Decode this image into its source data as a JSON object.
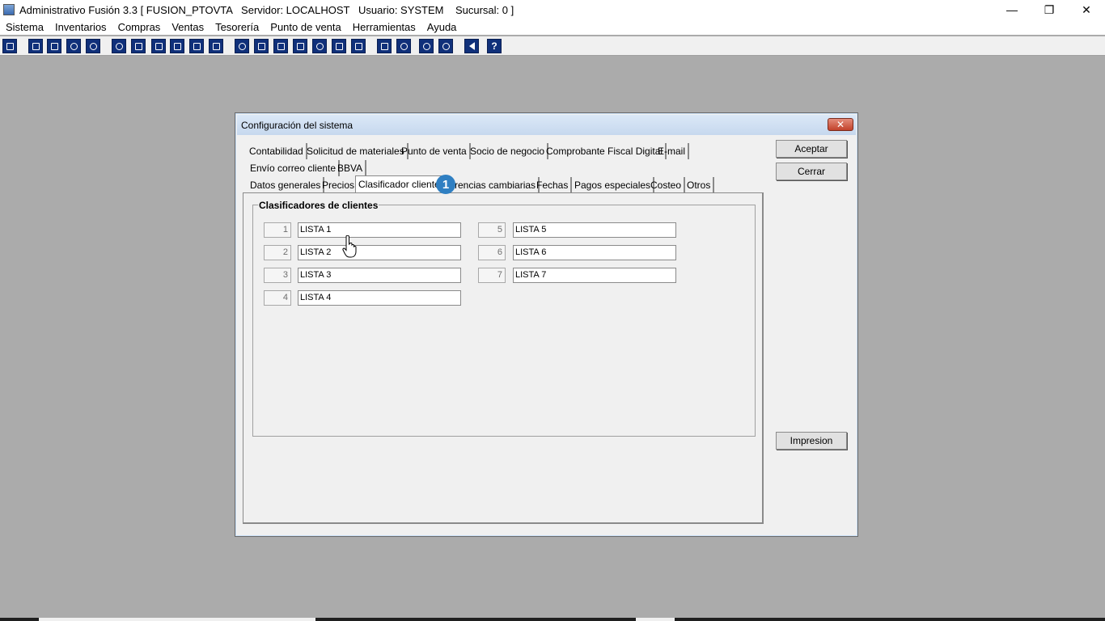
{
  "window": {
    "title": "Administrativo Fusión 3.3 [ FUSION_PTOVTA   Servidor: LOCALHOST   Usuario: SYSTEM    Sucursal: 0 ]",
    "minimize": "—",
    "restore": "❐",
    "close": "✕"
  },
  "menu": [
    "Sistema",
    "Inventarios",
    "Compras",
    "Ventas",
    "Tesorería",
    "Punto de venta",
    "Herramientas",
    "Ayuda"
  ],
  "toolbar": {
    "icons": [
      "calculator-icon",
      "copy-icon",
      "clipboard-icon",
      "swap-icon",
      "find-icon",
      "user-icon",
      "folder-icon",
      "print-icon",
      "printer-icon",
      "document-icon",
      "list-icon",
      "people-icon",
      "box-icon",
      "export-icon",
      "add-icon",
      "dollar-icon",
      "page-icon",
      "table-icon",
      "home-icon",
      "search-icon",
      "refresh-icon",
      "undo-icon",
      "back-icon",
      "help-icon"
    ]
  },
  "dialog": {
    "title": "Configuración del sistema",
    "close_label": "✕",
    "tabs_row1": [
      "Contabilidad",
      "Solicitud de materiales",
      "Punto de venta",
      "Socio de negocio",
      "Comprobante Fiscal Digital",
      "E-mail"
    ],
    "tabs_row2": [
      "Envío correo cliente",
      "BBVA"
    ],
    "tabs_row3": [
      "Datos generales",
      "Precios",
      "Clasificador cliente",
      "Diferencias cambiarias",
      "Fechas",
      "Pagos especiales",
      "Costeo",
      "Otros"
    ],
    "tab_row3_partial": "rencias cambiarias",
    "active_tab": "Clasificador cliente",
    "badge": "1",
    "group_title": "Clasificadores de clientes",
    "classifiers": [
      {
        "num": "1",
        "value": "LISTA 1"
      },
      {
        "num": "2",
        "value": "LISTA 2"
      },
      {
        "num": "3",
        "value": "LISTA 3"
      },
      {
        "num": "4",
        "value": "LISTA 4"
      },
      {
        "num": "5",
        "value": "LISTA 5"
      },
      {
        "num": "6",
        "value": "LISTA 6"
      },
      {
        "num": "7",
        "value": "LISTA 7"
      }
    ],
    "buttons": {
      "accept": "Aceptar",
      "close": "Cerrar",
      "print": "Impresion"
    }
  }
}
